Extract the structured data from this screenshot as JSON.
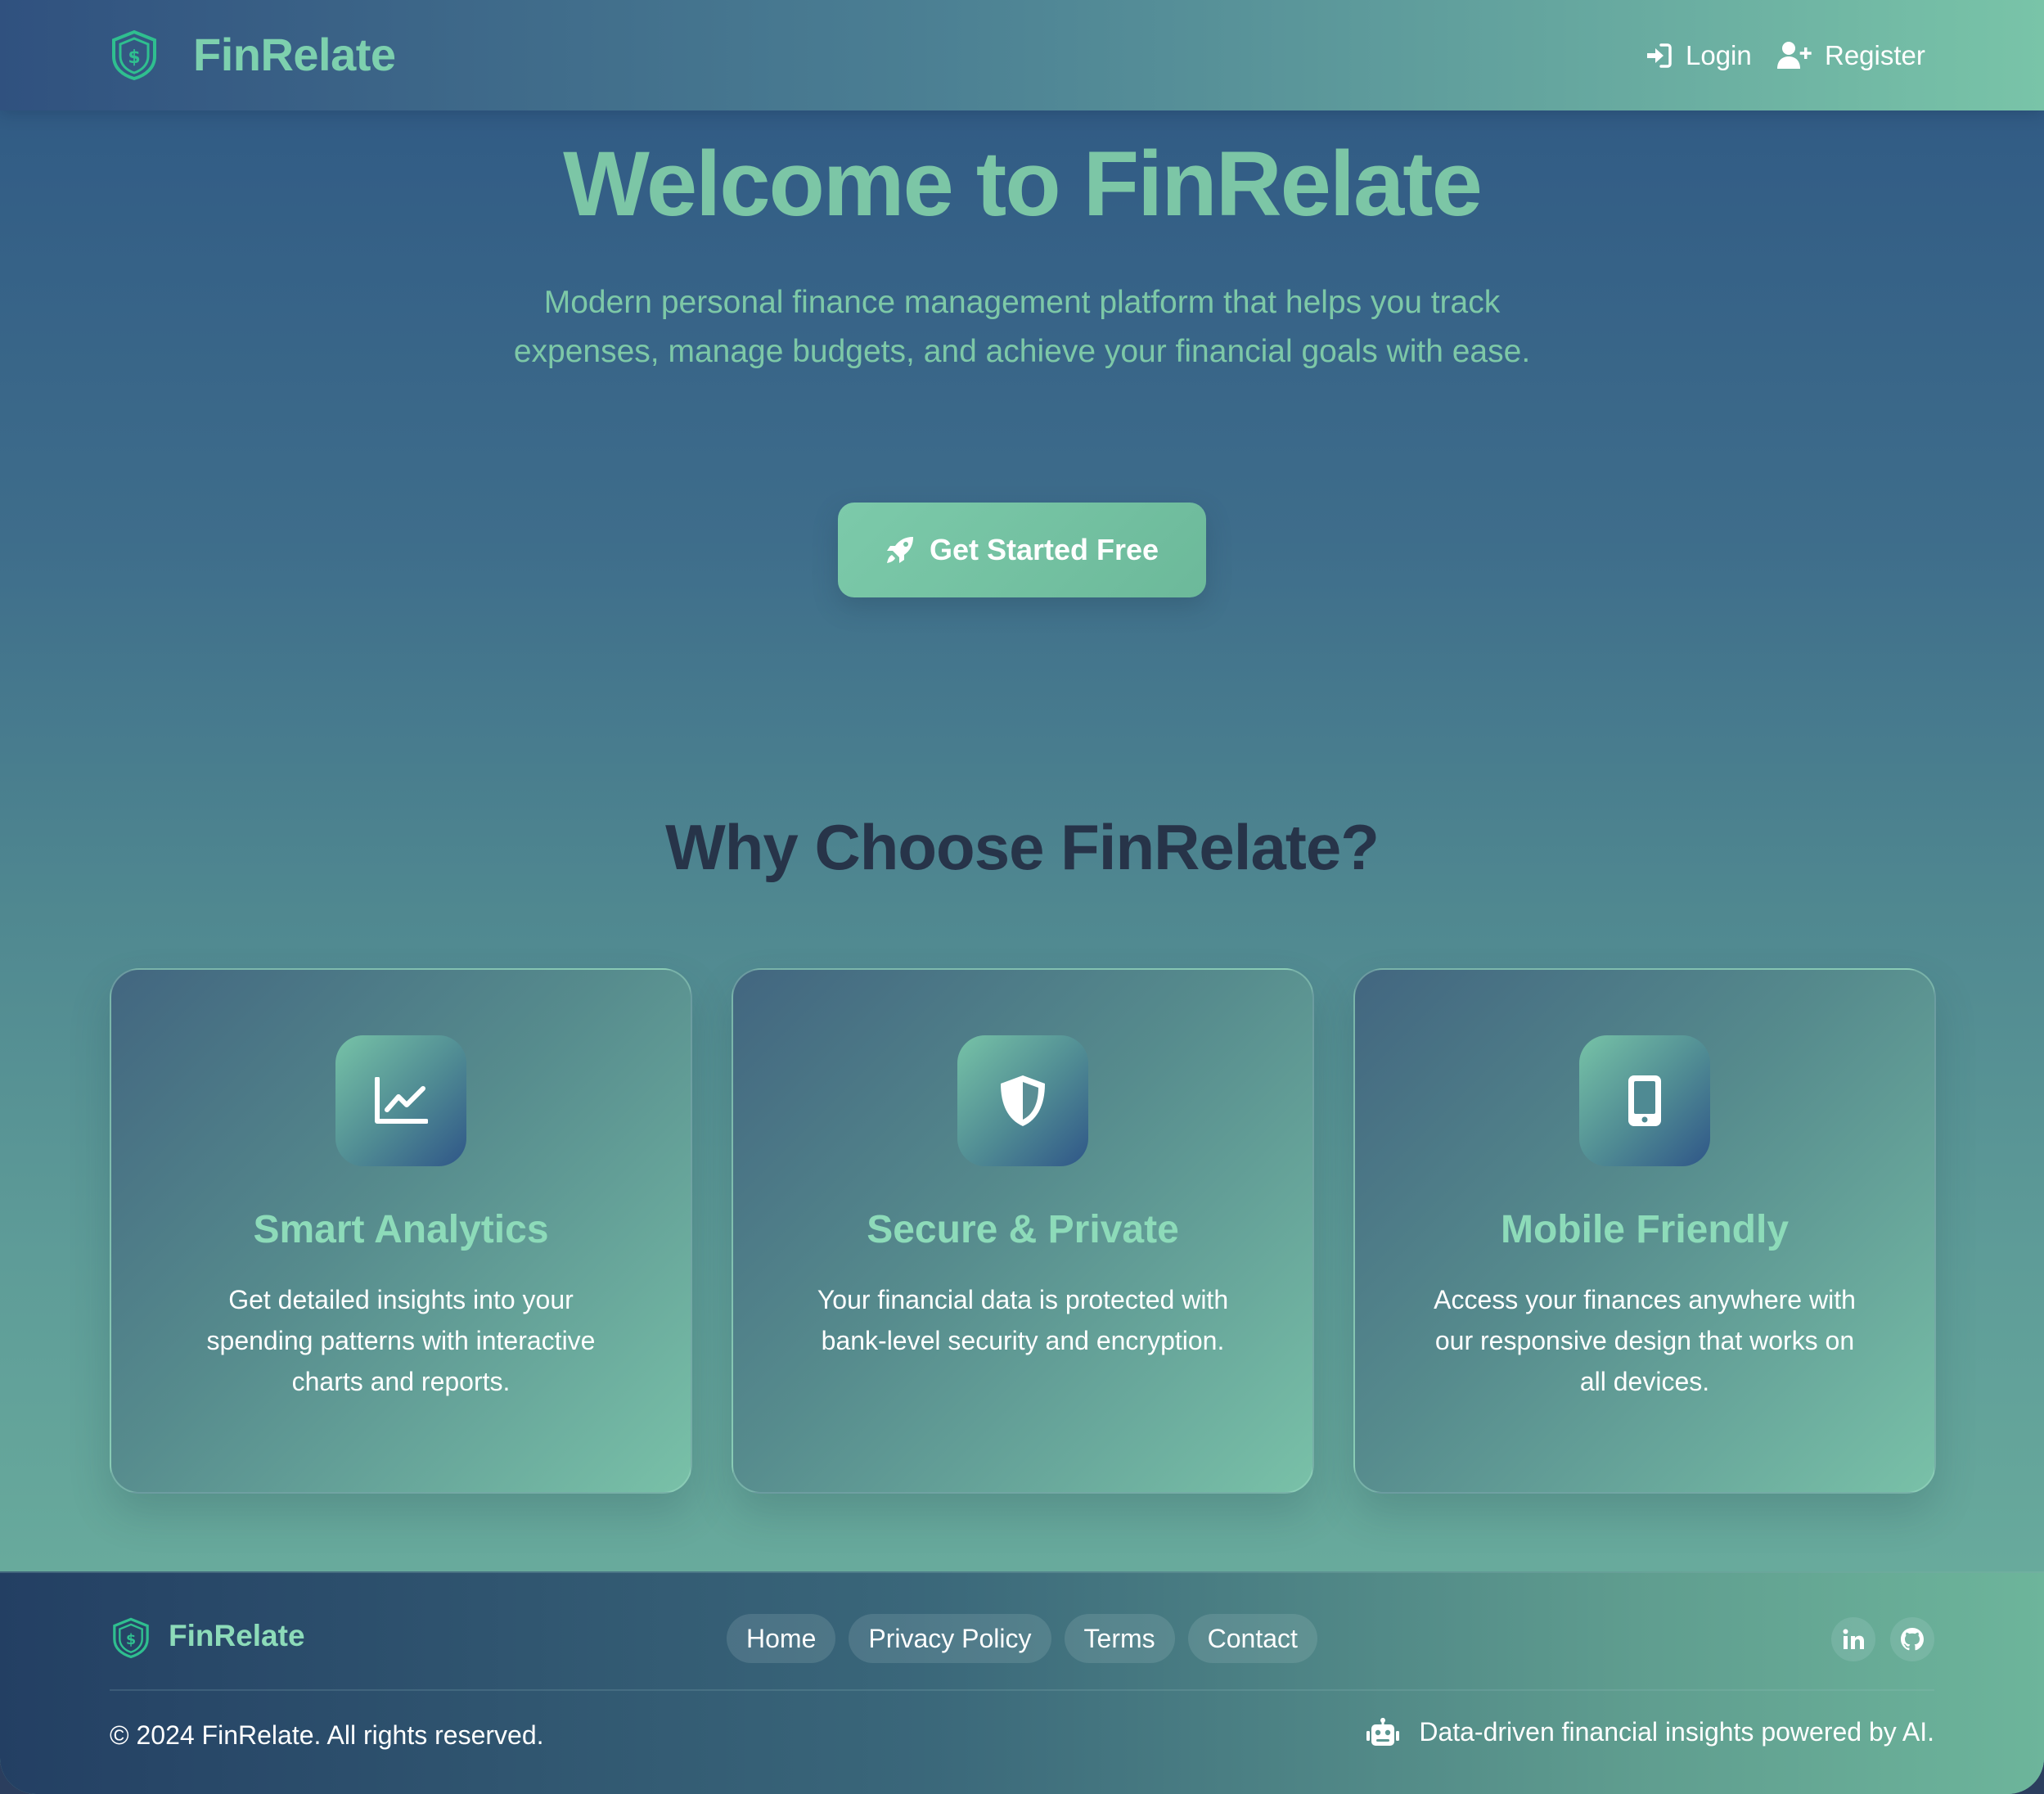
{
  "nav": {
    "brand": "FinRelate",
    "login_label": "Login",
    "register_label": "Register"
  },
  "hero": {
    "title": "Welcome to FinRelate",
    "subtitle": "Modern personal finance management platform that helps you track expenses, manage budgets, and achieve your financial goals with ease.",
    "cta_label": "Get Started Free"
  },
  "features": {
    "title": "Why Choose FinRelate?",
    "cards": [
      {
        "icon": "chart-line-icon",
        "title": "Smart Analytics",
        "text": "Get detailed insights into your spending patterns with interactive charts and reports."
      },
      {
        "icon": "shield-icon",
        "title": "Secure & Private",
        "text": "Your financial data is protected with bank-level security and encryption."
      },
      {
        "icon": "mobile-icon",
        "title": "Mobile Friendly",
        "text": "Access your finances anywhere with our responsive design that works on all devices."
      }
    ]
  },
  "footer": {
    "brand": "FinRelate",
    "links": [
      "Home",
      "Privacy Policy",
      "Terms",
      "Contact"
    ],
    "social": [
      "linkedin-icon",
      "github-icon"
    ],
    "copyright": "© 2024 FinRelate. All rights reserved.",
    "tagline": "Data-driven financial insights powered by AI."
  },
  "colors": {
    "accent": "#7cc6a6",
    "card_title": "#8ddbb9",
    "heading_dark": "#273449",
    "nav_start": "#30517f",
    "nav_end": "#79c4a8"
  }
}
